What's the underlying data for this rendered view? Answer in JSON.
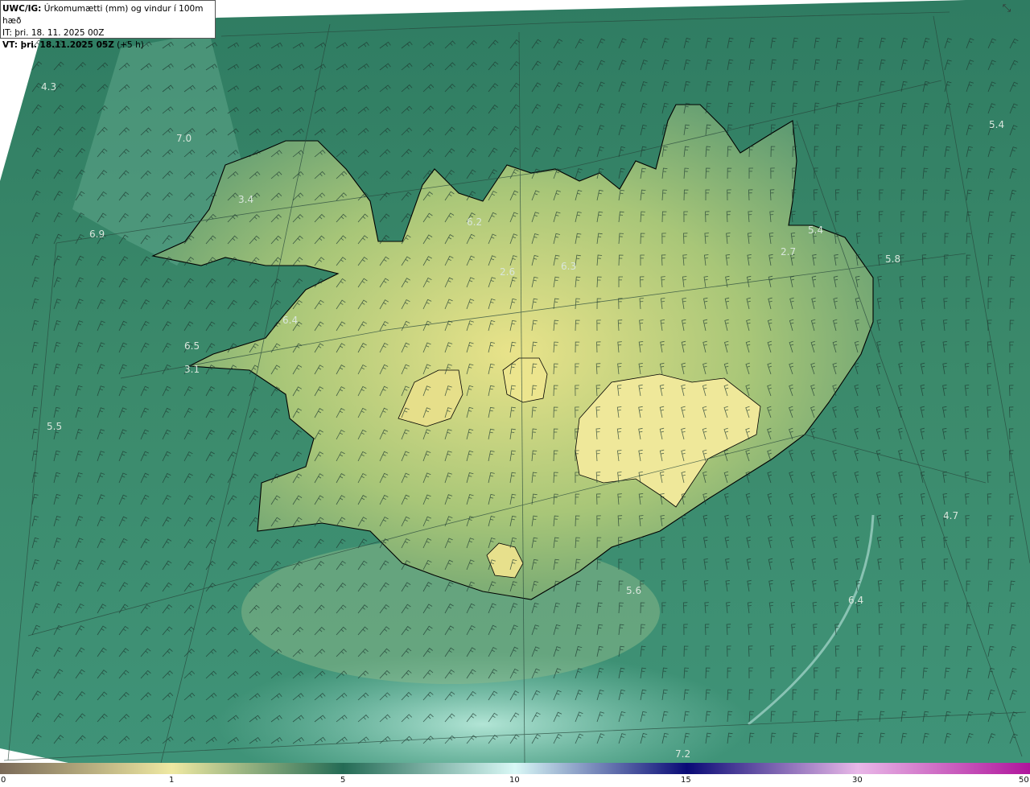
{
  "header": {
    "model_code": "UWC/IG:",
    "title": " Úrkomumætti (mm) og vindur í 100m hæð",
    "it_prefix": "IT:",
    "it_value": " þri. 18. 11. 2025 00Z",
    "vt_prefix": "VT:",
    "vt_value": " þri. 18.11.2025 05Z",
    "vt_offset": " (+5 h)"
  },
  "map_values": [
    "4.3",
    "7.0",
    "3.4",
    "6.9",
    "6.2",
    "2.6",
    "6.3",
    "5.4",
    "2.7",
    "5.8",
    "6.4",
    "6.5",
    "3.1",
    "5.5",
    "5.4",
    "4.7",
    "5.6",
    "6.4",
    "7.2"
  ],
  "colorbar": {
    "unit": "mm",
    "ticks": [
      "0",
      "1",
      "5",
      "10",
      "15",
      "30",
      "50"
    ],
    "colors": {
      "c0": "#7a6a58",
      "c1": "#efe9a2",
      "c5": "#246b55",
      "c10": "#d9f8f6",
      "c15": "#090a76",
      "c30": "#e9b8e8",
      "c50": "#b0159c"
    }
  },
  "icons": {
    "collapse": "collapse-icon"
  }
}
